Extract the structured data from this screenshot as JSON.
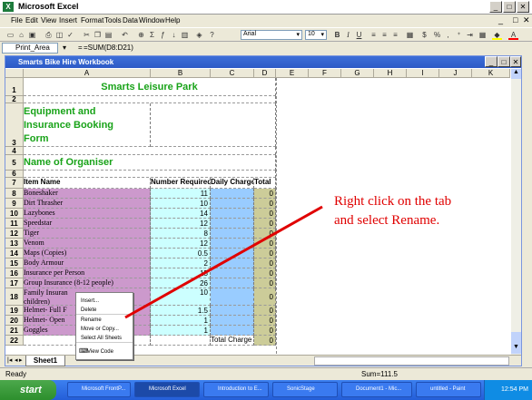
{
  "app": {
    "title": "Microsoft Excel"
  },
  "menu": [
    "File",
    "Edit",
    "View",
    "Insert",
    "Format",
    "Tools",
    "Data",
    "Window",
    "Help"
  ],
  "toolbar": {
    "font": "Arial",
    "size": "10",
    "zoom": "",
    "percent": "%"
  },
  "formula": {
    "namebox": "Print_Area",
    "fx": "=",
    "content": "=SUM(D8:D21)"
  },
  "workbook": {
    "title": "Smarts Bike Hire Workbook"
  },
  "columns": [
    "A",
    "B",
    "C",
    "D",
    "E",
    "F",
    "G",
    "H",
    "I",
    "J",
    "K"
  ],
  "sheet": {
    "header_title": "Smarts Leisure Park",
    "form_title_1": "Equipment and",
    "form_title_2": "Insurance Booking",
    "form_title_3": "Form",
    "organiser_label": "Name of Organiser",
    "col_item": "Item Name",
    "col_number": "Number Required",
    "col_charge": "Daily Charge",
    "col_total": "Total",
    "rows": [
      {
        "num": "8",
        "item": "Boneshaker",
        "qty": "11",
        "total": "0"
      },
      {
        "num": "9",
        "item": "Dirt Thrasher",
        "qty": "10",
        "total": "0"
      },
      {
        "num": "10",
        "item": "Lazybones",
        "qty": "14",
        "total": "0"
      },
      {
        "num": "11",
        "item": "Speedstar",
        "qty": "12",
        "total": "0"
      },
      {
        "num": "12",
        "item": "Tiger",
        "qty": "8",
        "total": "0"
      },
      {
        "num": "13",
        "item": "Venom",
        "qty": "12",
        "total": "0"
      },
      {
        "num": "14",
        "item": "Maps (Copies)",
        "qty": "0.5",
        "total": "0"
      },
      {
        "num": "15",
        "item": "Body Armour",
        "qty": "2",
        "total": "0"
      },
      {
        "num": "16",
        "item": "Insurance per Person",
        "qty": "15",
        "total": "0"
      },
      {
        "num": "17",
        "item": "Group Insurance (8-12 people)",
        "qty": "26",
        "total": "0"
      },
      {
        "num": "18",
        "item": "Family Insuran",
        "item2": "children)",
        "qty": "10",
        "total": "0"
      },
      {
        "num": "19",
        "item": "Helmet- Full F",
        "qty": "1.5",
        "total": "0"
      },
      {
        "num": "20",
        "item": "Helmet- Open",
        "qty": "1",
        "total": "0"
      },
      {
        "num": "21",
        "item": "Goggles",
        "qty": "1",
        "total": "0"
      },
      {
        "num": "22",
        "item": "",
        "qty": "",
        "charge": "Total Charge",
        "total": "0"
      }
    ],
    "tab_name": "Sheet1"
  },
  "context_menu": [
    "Insert...",
    "Delete",
    "Rename",
    "Move or Copy...",
    "Select All Sheets",
    "View Code"
  ],
  "annotation": {
    "line1": "Right click on the tab",
    "line2": "and select Rename."
  },
  "status": {
    "ready": "Ready",
    "sum": "Sum=111.5"
  },
  "taskbar": {
    "start": "start",
    "items": [
      "Microsoft FrontP...",
      "Microsoft Excel",
      "Introduction to E...",
      "SonicStage",
      "Document1 - Mic...",
      "untitled - Paint"
    ],
    "clock": "12:54 PM"
  },
  "colors": {
    "pink": "#cc99cc",
    "cyan": "#ccffff",
    "blue": "#99ccff",
    "olive": "#cccc99",
    "title_green": "#19a319",
    "annotation_red": "#e00000"
  }
}
